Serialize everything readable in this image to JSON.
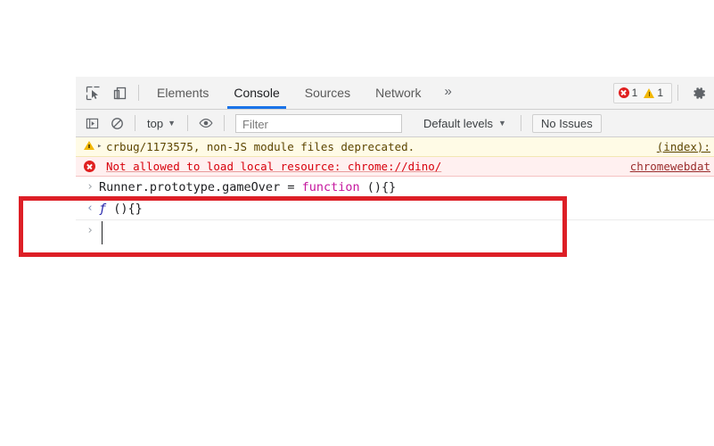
{
  "devtools": {
    "tabbar": {
      "inspect_icon": "inspect-element-icon",
      "device_icon": "device-toolbar-icon",
      "tabs": [
        {
          "label": "Elements",
          "active": false
        },
        {
          "label": "Console",
          "active": true
        },
        {
          "label": "Sources",
          "active": false
        },
        {
          "label": "Network",
          "active": false
        }
      ],
      "more_tabs_label": "»",
      "error_count": "1",
      "warning_count": "1",
      "settings_icon": "gear-icon"
    },
    "console_toolbar": {
      "sidebar_icon": "console-sidebar-icon",
      "clear_icon": "clear-console-icon",
      "context_label": "top",
      "context_caret": "▼",
      "eye_icon": "live-expression-eye-icon",
      "filter_placeholder": "Filter",
      "filter_value": "",
      "levels_label": "Default levels",
      "levels_caret": "▼",
      "issues_label": "No Issues"
    },
    "messages": [
      {
        "level": "warning",
        "icon": "warning-triangle-icon",
        "disclosure": "▸",
        "text": "crbug/1173575, non-JS module files deprecated.",
        "source": "(index):"
      },
      {
        "level": "error",
        "icon": "error-circle-icon",
        "disclosure": "",
        "text": "Not allowed to load local resource: chrome://dino/",
        "source": "chromewebdat"
      }
    ],
    "prompt": {
      "input_chevron": "›",
      "input_code_before": "Runner.prototype.gameOver = ",
      "input_keyword": "function",
      "input_code_after": " (){}",
      "result_chevron": "‹",
      "result_fn_glyph": "ƒ",
      "result_fn_tail": " (){}",
      "empty_chevron": "›"
    }
  },
  "annotation": {
    "name": "red-highlight-box",
    "color": "#dd1f26"
  }
}
